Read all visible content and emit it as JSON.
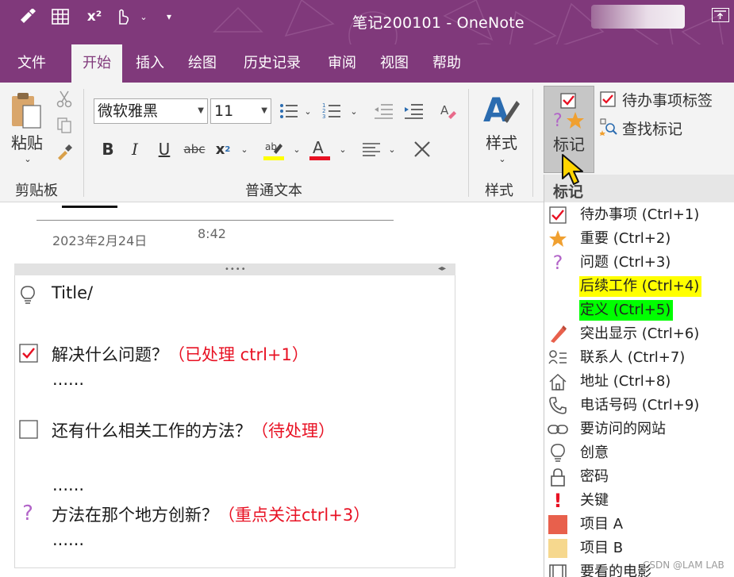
{
  "titlebar": {
    "title": "笔记200101  -  OneNote",
    "quick_access": {
      "superscript": "x²"
    }
  },
  "tabs": [
    {
      "label": "文件"
    },
    {
      "label": "开始"
    },
    {
      "label": "插入"
    },
    {
      "label": "绘图"
    },
    {
      "label": "历史记录"
    },
    {
      "label": "审阅"
    },
    {
      "label": "视图"
    },
    {
      "label": "帮助"
    }
  ],
  "ribbon": {
    "clipboard": {
      "paste_label": "粘贴",
      "group_label": "剪贴板"
    },
    "text": {
      "font_name": "微软雅黑",
      "font_size": "11",
      "group_label": "普通文本"
    },
    "styles": {
      "button_label": "样式",
      "group_label": "样式"
    },
    "tags": {
      "button_label": "标记",
      "todo_tag_label": "待办事项标签",
      "find_tags_label": "查找标记"
    }
  },
  "page": {
    "date": "2023年2月24日",
    "time": "8:42",
    "lines": [
      {
        "text": "Title/"
      },
      {
        "text": "解决什么问题？",
        "note": "（已处理 ctrl+1）"
      },
      {
        "text": "......"
      },
      {
        "text": "还有什么相关工作的方法？",
        "note": "（待处理）"
      },
      {
        "text": "......"
      },
      {
        "text": "方法在那个地方创新？",
        "note": "（重点关注ctrl+3）"
      },
      {
        "text": "......"
      }
    ]
  },
  "dropdown": {
    "header": "标记",
    "items": [
      {
        "label": "待办事项 (Ctrl+1)"
      },
      {
        "label": "重要 (Ctrl+2)"
      },
      {
        "label": "问题 (Ctrl+3)"
      },
      {
        "label": "后续工作 (Ctrl+4)",
        "highlight": "#ffff00"
      },
      {
        "label": "定义 (Ctrl+5)",
        "highlight": "#00ff00"
      },
      {
        "label": "突出显示 (Ctrl+6)"
      },
      {
        "label": "联系人 (Ctrl+7)"
      },
      {
        "label": "地址 (Ctrl+8)"
      },
      {
        "label": "电话号码 (Ctrl+9)"
      },
      {
        "label": "要访问的网站"
      },
      {
        "label": "创意"
      },
      {
        "label": "密码"
      },
      {
        "label": "关键"
      },
      {
        "label": "项目 A"
      },
      {
        "label": "项目 B"
      },
      {
        "label": "要看的电影"
      }
    ]
  },
  "colors": {
    "brand": "#80397b",
    "important_star": "#f0a030",
    "question": "#b264c8",
    "project_a": "#e8604c",
    "project_b": "#f6d88e",
    "critical": "#e81123"
  },
  "watermark": "CSDN @LAM LAB"
}
